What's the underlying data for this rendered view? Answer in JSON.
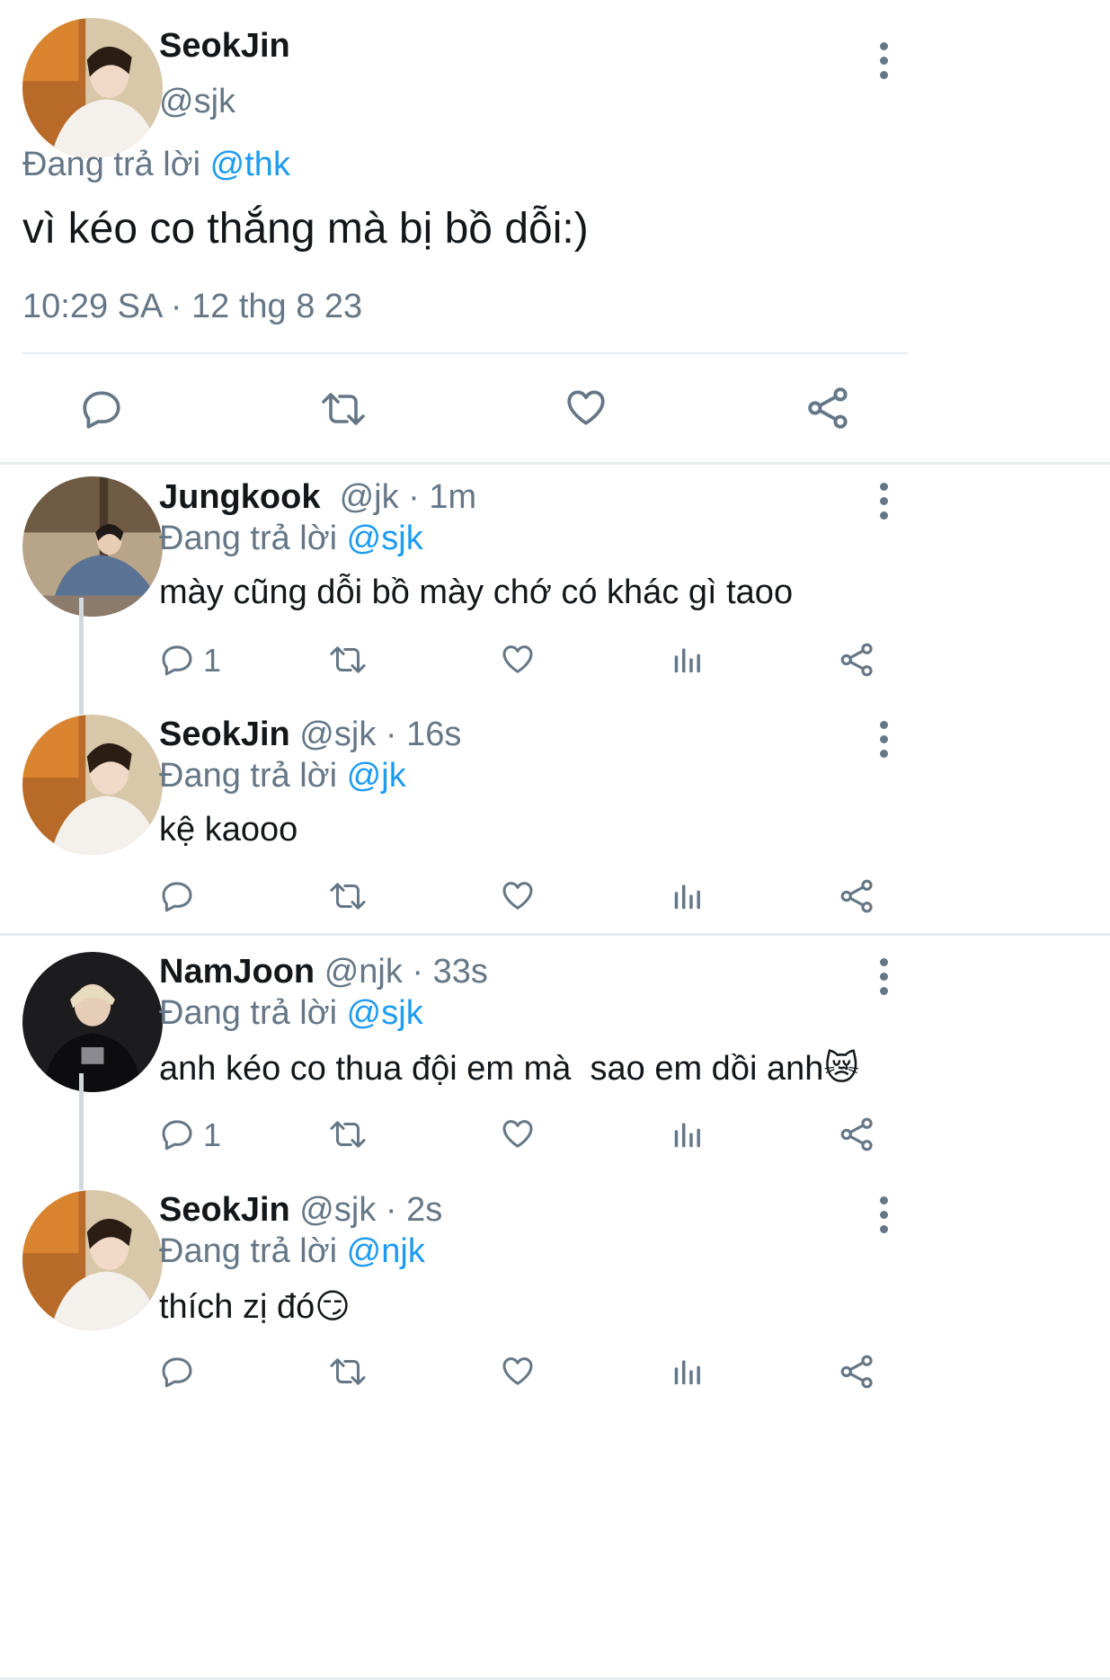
{
  "main_tweet": {
    "name": "SeokJin",
    "handle": "@sjk",
    "reply_prefix": "Đang trả lời",
    "reply_to": "@thk",
    "text": "vì kéo co thắng mà bị bồ dỗi:)",
    "timestamp": "10:29 SA · 12 thg 8 23"
  },
  "replies": [
    {
      "name": "Jungkook",
      "meta": "@jk · 1m",
      "reply_prefix": "Đang trả lời",
      "reply_to": "@sjk",
      "text": "mày cũng dỗi bồ mày chớ có khác gì taoo",
      "reply_count": "1"
    },
    {
      "name": "SeokJin",
      "meta": "@sjk · 16s",
      "reply_prefix": "Đang trả lời",
      "reply_to": "@jk",
      "text": "kệ kaooo",
      "reply_count": ""
    },
    {
      "name": "NamJoon",
      "meta": "@njk · 33s",
      "reply_prefix": "Đang trả lời",
      "reply_to": "@sjk",
      "text": "anh kéo co thua đội em mà  sao em dồi anh",
      "emoji": "😿",
      "reply_count": "1"
    },
    {
      "name": "SeokJin",
      "meta": "@sjk · 2s",
      "reply_prefix": "Đang trả lời",
      "reply_to": "@njk",
      "text": "thích zị đó",
      "emoji": "😏",
      "reply_count": ""
    }
  ],
  "icons": [
    "reply-icon",
    "retweet-icon",
    "like-icon",
    "views-icon",
    "share-icon",
    "more-options-icon"
  ],
  "colors": {
    "link": "#1d9bf0",
    "muted": "#657786",
    "divider": "#e6ecf0"
  }
}
